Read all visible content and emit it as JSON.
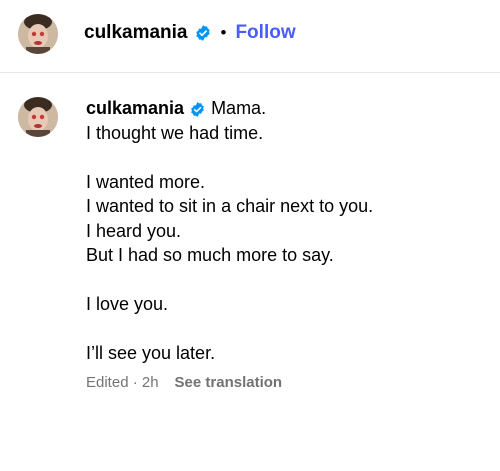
{
  "header": {
    "username": "culkamania",
    "separator": "•",
    "follow_label": "Follow"
  },
  "comment": {
    "username": "culkamania",
    "first_line_text": "Mama.",
    "lines": [
      "I thought we had time.",
      "",
      "I wanted more.",
      "I wanted to sit in a chair next to you.",
      "I heard you.",
      "But I had so much more to say.",
      "",
      "I love you.",
      "",
      "I’ll see you later."
    ],
    "meta": {
      "edited_time": "Edited · 2h",
      "translate_label": "See translation"
    }
  },
  "icons": {
    "verified": "verified-badge-icon",
    "avatar": "profile-avatar"
  },
  "colors": {
    "follow": "#4a5df9",
    "verified": "#0095f6",
    "meta_text": "#737373",
    "divider": "#e6e6e6"
  }
}
